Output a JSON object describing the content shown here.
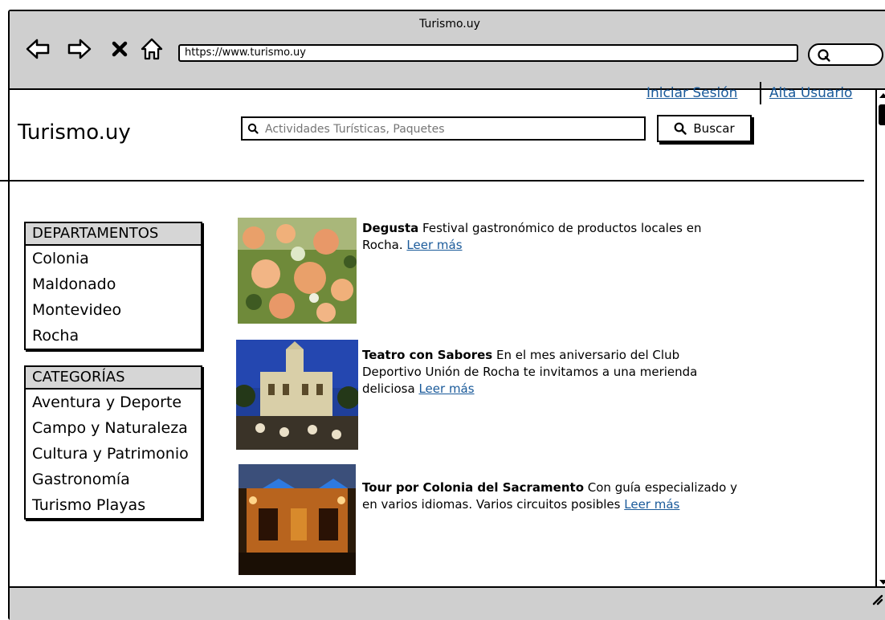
{
  "window": {
    "title": "Turismo.uy"
  },
  "browser": {
    "url": "https://www.turismo.uy",
    "nav_icons": [
      "back-arrow-icon",
      "forward-arrow-icon",
      "close-x-icon",
      "home-icon"
    ]
  },
  "header": {
    "logo": "Turismo.uy",
    "login_link": "Iniciar Sesión",
    "signup_link": "Alta Usuario",
    "search": {
      "placeholder": "Actividades Turísticas, Paquetes",
      "value": ""
    },
    "search_button": "Buscar"
  },
  "sidebar": {
    "departamentos": {
      "title": "DEPARTAMENTOS",
      "items": [
        "Colonia",
        "Maldonado",
        "Montevideo",
        "Rocha"
      ]
    },
    "categorias": {
      "title": "CATEGORÍAS",
      "items": [
        "Aventura y Deporte",
        "Campo y Naturaleza",
        "Cultura y Patrimonio",
        "Gastronomía",
        "Turismo Playas"
      ]
    }
  },
  "activities": [
    {
      "title": "Degusta",
      "text": " Festival gastronómico de productos locales en Rocha. ",
      "link": "Leer más"
    },
    {
      "title": "Teatro con Sabores",
      "text": " En el mes aniversario del Club Deportivo Unión de Rocha te invitamos a una merienda deliciosa ",
      "link": "Leer más"
    },
    {
      "title": "Tour por Colonia del Sacramento",
      "text": " Con guía especializado y en varios idiomas. Varios circuitos posibles ",
      "link": "Leer más"
    }
  ]
}
